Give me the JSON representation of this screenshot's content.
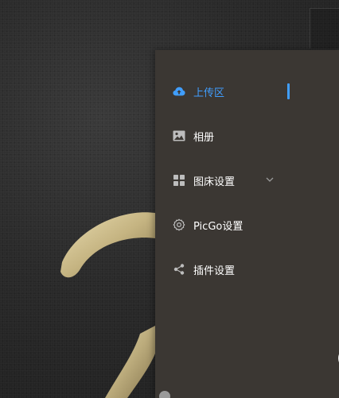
{
  "sidebar": {
    "items": [
      {
        "label": "上传区",
        "icon": "cloud-upload-icon",
        "active": true
      },
      {
        "label": "相册",
        "icon": "image-icon",
        "active": false
      },
      {
        "label": "图床设置",
        "icon": "grid-icon",
        "active": false,
        "expandable": true
      },
      {
        "label": "PicGo设置",
        "icon": "gear-icon",
        "active": false
      },
      {
        "label": "插件设置",
        "icon": "share-icon",
        "active": false
      }
    ]
  },
  "colors": {
    "accent": "#409eff",
    "sidebar_bg": "#3b3733",
    "text": "#ffffff",
    "icon": "#bdbdbd"
  }
}
